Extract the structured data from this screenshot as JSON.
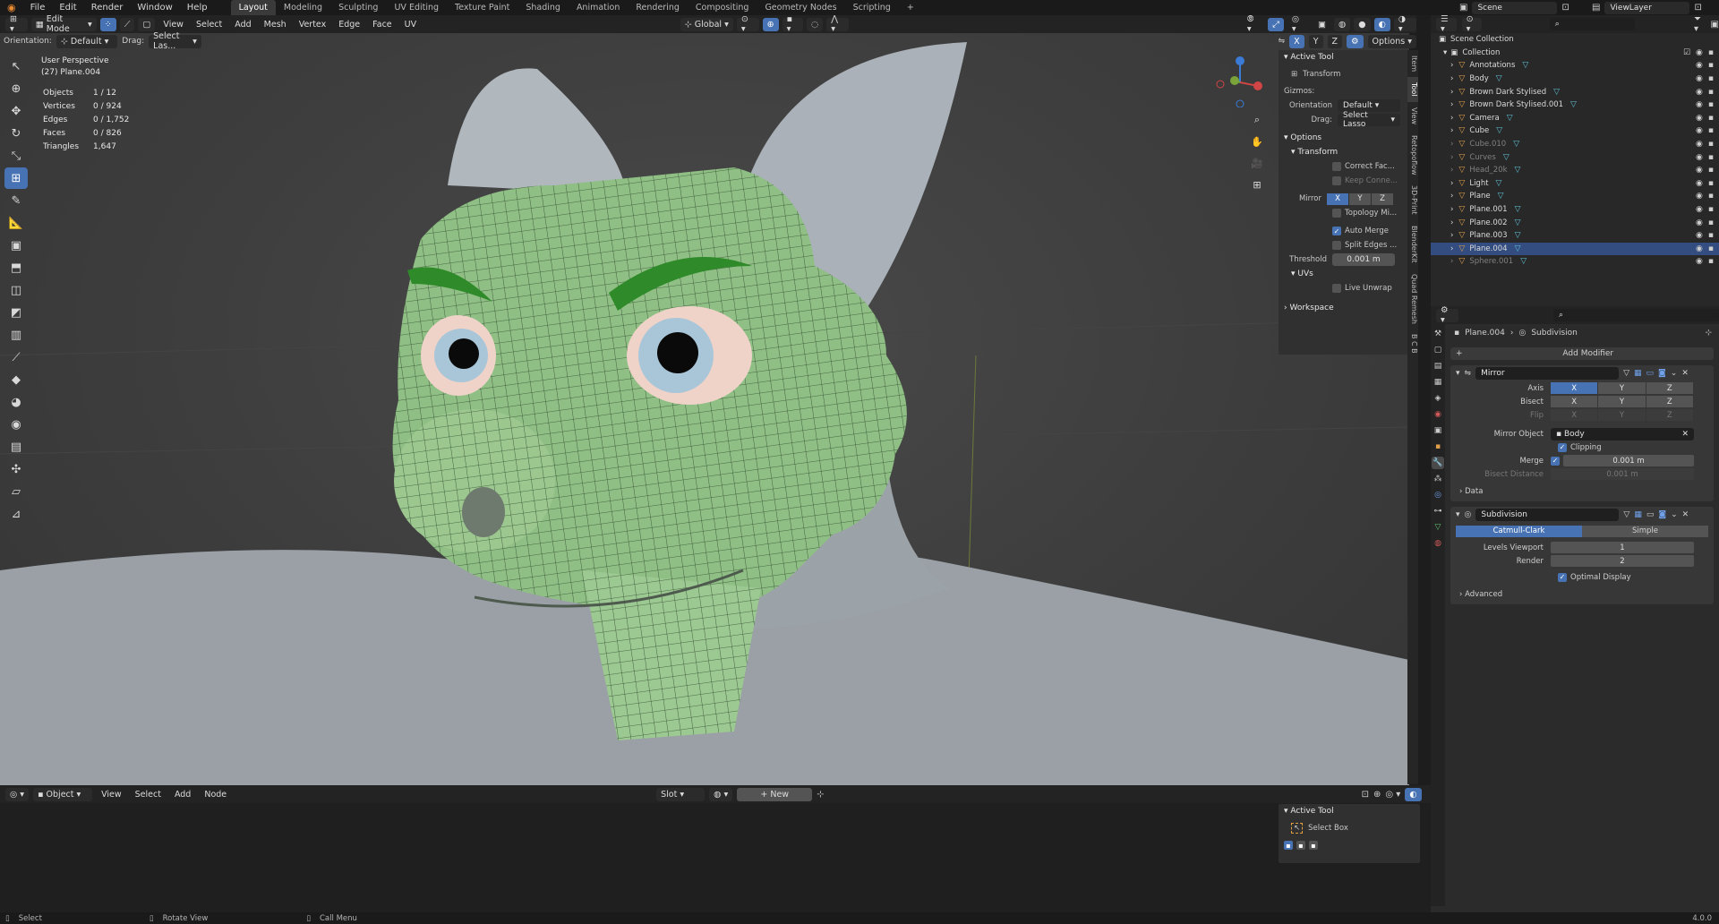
{
  "menu": {
    "items": [
      "File",
      "Edit",
      "Render",
      "Window",
      "Help"
    ],
    "workspaces": [
      "Layout",
      "Modeling",
      "Sculpting",
      "UV Editing",
      "Texture Paint",
      "Shading",
      "Animation",
      "Rendering",
      "Compositing",
      "Geometry Nodes",
      "Scripting"
    ],
    "active_workspace": "Layout",
    "add_tab": "+",
    "scene": "Scene",
    "view_layer": "ViewLayer"
  },
  "viewport": {
    "mode": "Edit Mode",
    "menus": [
      "View",
      "Select",
      "Add",
      "Mesh",
      "Vertex",
      "Edge",
      "Face",
      "UV"
    ],
    "transform_orientation": "Global",
    "options_label": "Options",
    "axes": [
      "X",
      "Y",
      "Z"
    ],
    "orientation_label": "Orientation:",
    "orientation_value": "Default",
    "drag_label": "Drag:",
    "drag_value": "Select Las...",
    "perspective": "User Perspective",
    "object_name": "(27) Plane.004",
    "stats": [
      {
        "label": "Objects",
        "value": "1 / 12"
      },
      {
        "label": "Vertices",
        "value": "0 / 924"
      },
      {
        "label": "Edges",
        "value": "0 / 1,752"
      },
      {
        "label": "Faces",
        "value": "0 / 826"
      },
      {
        "label": "Triangles",
        "value": "1,647"
      }
    ]
  },
  "npanel": {
    "active_tool_title": "Active Tool",
    "tool_name": "Transform",
    "gizmos_label": "Gizmos:",
    "orientation_label": "Orientation",
    "orientation_value": "Default",
    "drag_label": "Drag:",
    "drag_value": "Select Lasso",
    "options_title": "Options",
    "transform_title": "Transform",
    "correct_faces": "Correct Fac...",
    "keep_connected": "Keep Conne...",
    "mirror_label": "Mirror",
    "mirror_axes": [
      "X",
      "Y",
      "Z"
    ],
    "topology_mirror": "Topology Mi...",
    "auto_merge": "Auto Merge",
    "split_edges": "Split Edges ...",
    "threshold_label": "Threshold",
    "threshold_value": "0.001 m",
    "uvs_title": "UVs",
    "live_unwrap": "Live Unwrap",
    "workspace_title": "Workspace",
    "tabs": [
      "Item",
      "Tool",
      "View",
      "Retopoflow",
      "3D-Print",
      "BlenderKit",
      "Quad Remesh",
      "B C B"
    ]
  },
  "outliner": {
    "root": "Scene Collection",
    "collection": "Collection",
    "items": [
      {
        "name": "Annotations",
        "dim": false,
        "sel": false
      },
      {
        "name": "Body",
        "dim": false,
        "sel": false
      },
      {
        "name": "Brown Dark Stylised",
        "dim": false,
        "sel": false
      },
      {
        "name": "Brown Dark Stylised.001",
        "dim": false,
        "sel": false
      },
      {
        "name": "Camera",
        "dim": false,
        "sel": false
      },
      {
        "name": "Cube",
        "dim": false,
        "sel": false
      },
      {
        "name": "Cube.010",
        "dim": true,
        "sel": false
      },
      {
        "name": "Curves",
        "dim": true,
        "sel": false
      },
      {
        "name": "Head_20k",
        "dim": true,
        "sel": false
      },
      {
        "name": "Light",
        "dim": false,
        "sel": false
      },
      {
        "name": "Plane",
        "dim": false,
        "sel": false
      },
      {
        "name": "Plane.001",
        "dim": false,
        "sel": false
      },
      {
        "name": "Plane.002",
        "dim": false,
        "sel": false
      },
      {
        "name": "Plane.003",
        "dim": false,
        "sel": false
      },
      {
        "name": "Plane.004",
        "dim": false,
        "sel": true
      },
      {
        "name": "Sphere.001",
        "dim": true,
        "sel": false
      }
    ]
  },
  "properties": {
    "breadcrumb_object": "Plane.004",
    "breadcrumb_modifier": "Subdivision",
    "add_modifier": "Add Modifier",
    "mirror": {
      "name": "Mirror",
      "axis_label": "Axis",
      "bisect_label": "Bisect",
      "flip_label": "Flip",
      "axes": [
        "X",
        "Y",
        "Z"
      ],
      "mirror_object_label": "Mirror Object",
      "mirror_object_value": "Body",
      "clipping": "Clipping",
      "merge_label": "Merge",
      "merge_value": "0.001 m",
      "bisect_distance_label": "Bisect Distance",
      "bisect_distance_value": "0.001 m",
      "data_label": "Data"
    },
    "subdivision": {
      "name": "Subdivision",
      "catmull": "Catmull-Clark",
      "simple": "Simple",
      "levels_viewport_label": "Levels Viewport",
      "levels_viewport_value": "1",
      "render_label": "Render",
      "render_value": "2",
      "optimal_display": "Optimal Display",
      "advanced": "Advanced"
    }
  },
  "shader_editor": {
    "type": "Object",
    "menus": [
      "View",
      "Select",
      "Add",
      "Node"
    ],
    "slot": "Slot",
    "new_label": "New",
    "active_tool_title": "Active Tool",
    "tool_name": "Select Box"
  },
  "statusbar": {
    "select": "Select",
    "rotate": "Rotate View",
    "call_menu": "Call Menu",
    "version": "4.0.0"
  }
}
